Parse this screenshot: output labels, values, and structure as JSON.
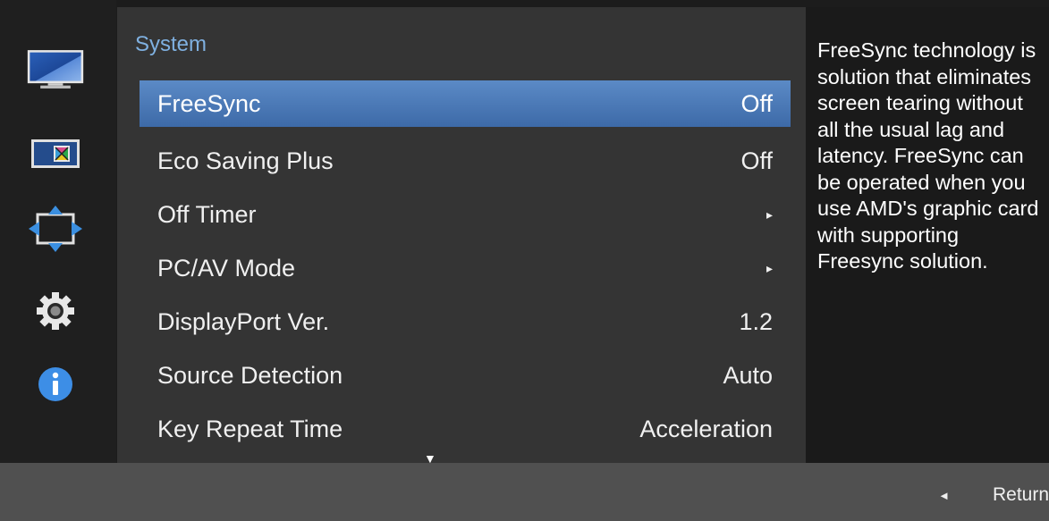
{
  "menu": {
    "title": "System",
    "items": [
      {
        "label": "FreeSync",
        "value": "Off",
        "selected": true
      },
      {
        "label": "Eco Saving Plus",
        "value": "Off"
      },
      {
        "label": "Off Timer",
        "value": "▸"
      },
      {
        "label": "PC/AV Mode",
        "value": "▸"
      },
      {
        "label": "DisplayPort Ver.",
        "value": "1.2"
      },
      {
        "label": "Source Detection",
        "value": "Auto"
      },
      {
        "label": "Key Repeat Time",
        "value": "Acceleration"
      }
    ],
    "scroll_indicator": "▼"
  },
  "sidebar": {
    "icons": [
      "monitor-picture-icon",
      "color-screen-icon",
      "screen-size-icon",
      "gear-icon",
      "info-icon"
    ],
    "selected_index": 3
  },
  "help": {
    "text": "FreeSync technology is solution that eliminates screen tearing without all the usual lag and latency. FreeSync can be operated when you use AMD's graphic card with supporting Freesync solution."
  },
  "footer": {
    "return_arrow": "◄",
    "return_label": "Return"
  },
  "colors": {
    "selection": "#4a78b8",
    "title": "#7fb0e0",
    "panel": "#343434",
    "bottom_bar": "#505050"
  }
}
